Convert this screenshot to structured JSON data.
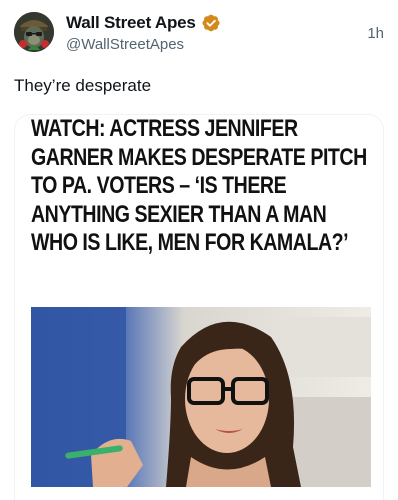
{
  "post": {
    "author": {
      "display_name": "Wall Street Apes",
      "handle": "@WallStreetApes",
      "verified": true
    },
    "timestamp": "1h",
    "text": "They’re desperate"
  },
  "article_card": {
    "headline": "WATCH: ACTRESS JENNIFER GARNER MAKES DESPERATE PITCH TO PA. VOTERS – ‘IS THERE ANYTHING SEXIER THAN A MAN WHO IS LIKE, MEN FOR KAMALA?’",
    "image": "woman-with-glasses-speaking-photo"
  },
  "colors": {
    "verified_badge": "#d4891c",
    "secondary_text": "#536471",
    "primary_text": "#0f1419"
  }
}
